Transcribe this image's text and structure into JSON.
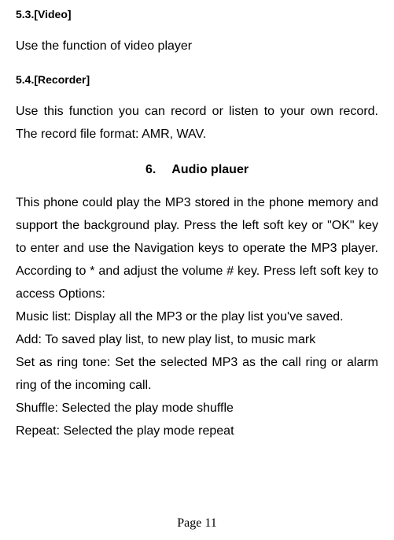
{
  "section53": {
    "heading": "5.3.[Video]",
    "body": "Use the function of video player"
  },
  "section54": {
    "heading": "5.4.[Recorder]",
    "body": "Use this function you can record or listen to your own record. The record file format: AMR, WAV."
  },
  "chapter6": {
    "number": "6.",
    "title": "Audio plauer",
    "intro": "This phone could play the MP3 stored in the phone memory and support the background play. Press the left soft key or \"OK\" key to enter and use the Navigation keys to operate the MP3 player. According to * and adjust the volume # key. Press left soft key to access Options:",
    "items": [
      "Music list: Display all the MP3 or the play list you've saved.",
      "Add: To saved play list, to new play list, to music mark",
      "Set as ring tone: Set the selected MP3 as the call ring or alarm ring of the incoming call.",
      "Shuffle: Selected the play mode shuffle",
      "Repeat: Selected the play mode repeat"
    ]
  },
  "footer": "Page 11"
}
